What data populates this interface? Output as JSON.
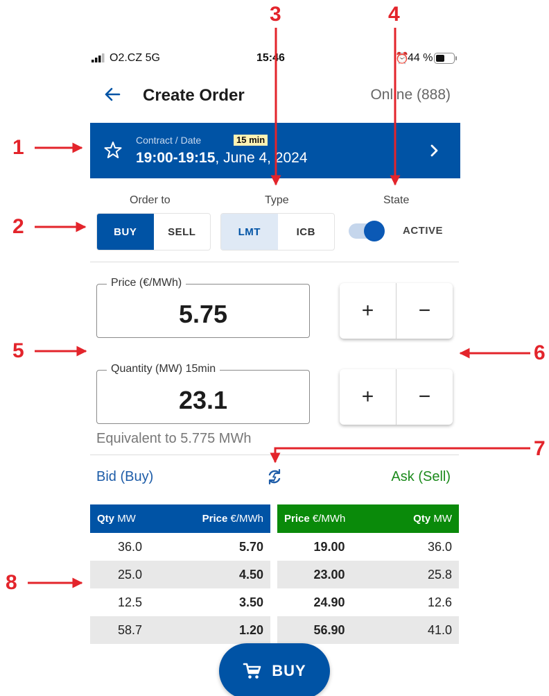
{
  "status_bar": {
    "carrier": "O2.CZ 5G",
    "time": "15:46",
    "battery": "44 %"
  },
  "header": {
    "title": "Create Order",
    "online": "Online (888)"
  },
  "contract": {
    "label": "Contract / Date",
    "badge": "15 min",
    "time_range": "19:00-19:15",
    "date": ", June 4, 2024"
  },
  "order": {
    "order_to_label": "Order to",
    "type_label": "Type",
    "state_label": "State",
    "buy": "BUY",
    "sell": "SELL",
    "lmt": "LMT",
    "icb": "ICB",
    "state_value": "ACTIVE",
    "state_on": true
  },
  "price": {
    "legend": "Price (€/MWh)",
    "value": "5.75"
  },
  "quantity": {
    "legend": "Quantity (MW) 15min",
    "value": "23.1",
    "equivalent": "Equivalent to 5.775 MWh"
  },
  "stepper": {
    "plus": "+",
    "minus": "−"
  },
  "book": {
    "bid_label": "Bid (Buy)",
    "ask_label": "Ask (Sell)",
    "bid_headers": {
      "qty": "Qty",
      "qty_unit": "MW",
      "price": "Price",
      "price_unit": "€/MWh"
    },
    "ask_headers": {
      "price": "Price",
      "price_unit": "€/MWh",
      "qty": "Qty",
      "qty_unit": "MW"
    },
    "bids": [
      {
        "qty": "36.0",
        "price": "5.70"
      },
      {
        "qty": "25.0",
        "price": "4.50"
      },
      {
        "qty": "12.5",
        "price": "3.50"
      },
      {
        "qty": "58.7",
        "price": "1.20"
      }
    ],
    "asks": [
      {
        "price": "19.00",
        "qty": "36.0"
      },
      {
        "price": "23.00",
        "qty": "25.8"
      },
      {
        "price": "24.90",
        "qty": "12.6"
      },
      {
        "price": "56.90",
        "qty": "41.0"
      }
    ]
  },
  "buy_button": "BUY",
  "annotations": [
    "1",
    "2",
    "3",
    "4",
    "5",
    "6",
    "7",
    "8"
  ],
  "colors": {
    "brand_blue": "#0053a5",
    "ask_green": "#0a8a0a",
    "annotation_red": "#e3242b"
  },
  "icons": [
    "back-arrow-icon",
    "star-icon",
    "chevron-right-icon",
    "refresh-icon",
    "cart-icon",
    "signal-icon",
    "alarm-icon",
    "battery-icon"
  ]
}
